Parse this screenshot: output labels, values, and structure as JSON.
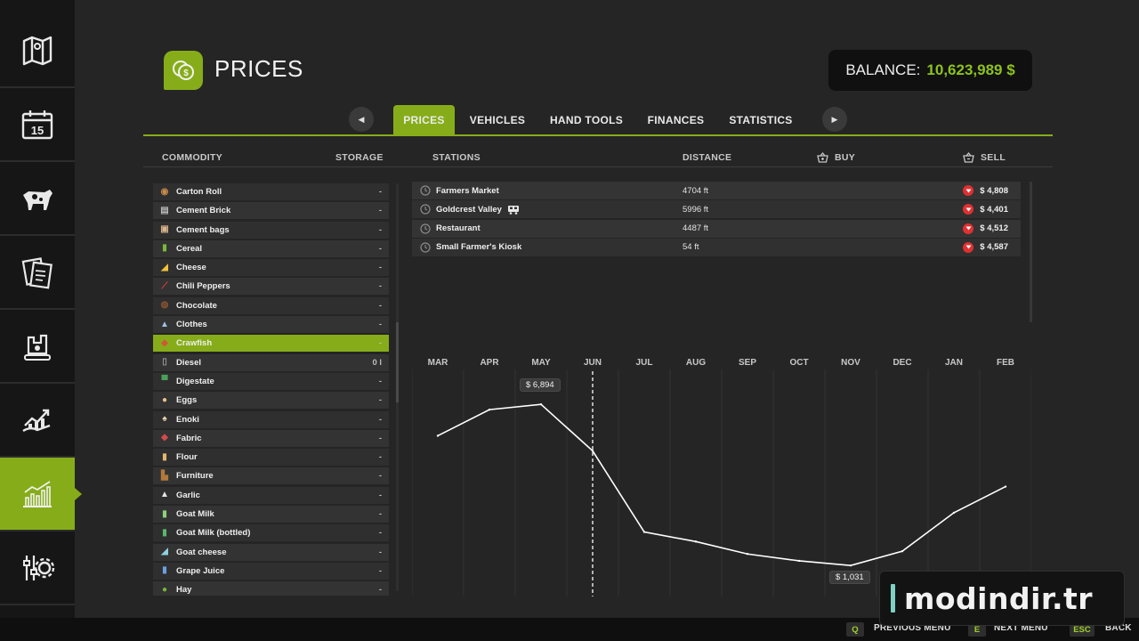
{
  "sidebar": {
    "items": [
      {
        "name": "map",
        "active": false
      },
      {
        "name": "calendar",
        "active": false,
        "badge": "15"
      },
      {
        "name": "animals",
        "active": false
      },
      {
        "name": "contracts",
        "active": false
      },
      {
        "name": "production",
        "active": false
      },
      {
        "name": "finances",
        "active": false
      },
      {
        "name": "prices",
        "active": true
      },
      {
        "name": "settings",
        "active": false
      }
    ]
  },
  "header": {
    "title": "PRICES",
    "balance_label": "BALANCE:",
    "balance_value": "10,623,989 $"
  },
  "tabs": [
    {
      "label": "PRICES",
      "active": true
    },
    {
      "label": "VEHICLES",
      "active": false
    },
    {
      "label": "HAND TOOLS",
      "active": false
    },
    {
      "label": "FINANCES",
      "active": false
    },
    {
      "label": "STATISTICS",
      "active": false
    }
  ],
  "columns": {
    "commodity": "COMMODITY",
    "storage": "STORAGE",
    "stations": "STATIONS",
    "distance": "DISTANCE",
    "buy": "BUY",
    "sell": "SELL"
  },
  "commodities": [
    {
      "name": "Carton Roll",
      "storage": "-",
      "icon": "carton-roll-icon",
      "glyph": "◉",
      "color": "#c98a4a"
    },
    {
      "name": "Cement Brick",
      "storage": "-",
      "icon": "cement-brick-icon",
      "glyph": "▤",
      "color": "#b8b8b8"
    },
    {
      "name": "Cement bags",
      "storage": "-",
      "icon": "cement-bags-icon",
      "glyph": "▣",
      "color": "#d8b48a"
    },
    {
      "name": "Cereal",
      "storage": "-",
      "icon": "cereal-icon",
      "glyph": "▮",
      "color": "#79b83a"
    },
    {
      "name": "Cheese",
      "storage": "-",
      "icon": "cheese-icon",
      "glyph": "◢",
      "color": "#f0c23a"
    },
    {
      "name": "Chili Peppers",
      "storage": "-",
      "icon": "chili-peppers-icon",
      "glyph": "⟋",
      "color": "#e04030"
    },
    {
      "name": "Chocolate",
      "storage": "-",
      "icon": "chocolate-icon",
      "glyph": "◍",
      "color": "#8a5530"
    },
    {
      "name": "Clothes",
      "storage": "-",
      "icon": "clothes-icon",
      "glyph": "▲",
      "color": "#9cc0e0"
    },
    {
      "name": "Crawfish",
      "storage": "-",
      "icon": "crawfish-icon",
      "glyph": "◆",
      "color": "#d0583a",
      "active": true
    },
    {
      "name": "Diesel",
      "storage": "0 l",
      "icon": "diesel-icon",
      "glyph": "▯",
      "color": "#9a9a9a"
    },
    {
      "name": "Digestate",
      "storage": "-",
      "icon": "digestate-icon",
      "glyph": "▀",
      "color": "#4aa05a"
    },
    {
      "name": "Eggs",
      "storage": "-",
      "icon": "eggs-icon",
      "glyph": "●",
      "color": "#e8c28a"
    },
    {
      "name": "Enoki",
      "storage": "-",
      "icon": "enoki-icon",
      "glyph": "♠",
      "color": "#e8d8b0"
    },
    {
      "name": "Fabric",
      "storage": "-",
      "icon": "fabric-icon",
      "glyph": "◆",
      "color": "#d24a4a"
    },
    {
      "name": "Flour",
      "storage": "-",
      "icon": "flour-icon",
      "glyph": "▮",
      "color": "#e0b870"
    },
    {
      "name": "Furniture",
      "storage": "-",
      "icon": "furniture-icon",
      "glyph": "▙",
      "color": "#b07a3a"
    },
    {
      "name": "Garlic",
      "storage": "-",
      "icon": "garlic-icon",
      "glyph": "▲",
      "color": "#e6e6e6"
    },
    {
      "name": "Goat Milk",
      "storage": "-",
      "icon": "goat-milk-icon",
      "glyph": "▮",
      "color": "#8fd07a"
    },
    {
      "name": "Goat Milk (bottled)",
      "storage": "-",
      "icon": "goat-milk-bottled-icon",
      "glyph": "▮",
      "color": "#5ab86a"
    },
    {
      "name": "Goat cheese",
      "storage": "-",
      "icon": "goat-cheese-icon",
      "glyph": "◢",
      "color": "#8fd0e0"
    },
    {
      "name": "Grape Juice",
      "storage": "-",
      "icon": "grape-juice-icon",
      "glyph": "▮",
      "color": "#6aa0e0"
    },
    {
      "name": "Hay",
      "storage": "-",
      "icon": "hay-icon",
      "glyph": "●",
      "color": "#79b83a"
    }
  ],
  "stations": [
    {
      "name": "Farmers Market",
      "distance": "4704 ft",
      "sell": "$ 4,808",
      "train": false
    },
    {
      "name": "Goldcrest Valley",
      "distance": "5996 ft",
      "sell": "$ 4,401",
      "train": true
    },
    {
      "name": "Restaurant",
      "distance": "4487 ft",
      "sell": "$ 4,512",
      "train": false
    },
    {
      "name": "Small Farmer's Kiosk",
      "distance": "54 ft",
      "sell": "$ 4,587",
      "train": false
    }
  ],
  "chart_data": {
    "type": "line",
    "categories": [
      "MAR",
      "APR",
      "MAY",
      "JUN",
      "JUL",
      "AUG",
      "SEP",
      "OCT",
      "NOV",
      "DEC",
      "JAN",
      "FEB"
    ],
    "values": [
      5750,
      6700,
      6894,
      5200,
      2250,
      1900,
      1450,
      1200,
      1031,
      1550,
      2950,
      3900
    ],
    "current_month": "JUN",
    "max_label": "$ 6,894",
    "min_label": "$ 1,031",
    "ylim": [
      0,
      8000
    ],
    "grid": true,
    "line_color": "#ffffff"
  },
  "footer": {
    "prev_key": "Q",
    "prev_label": "PREVIOUS MENU",
    "next_key": "E",
    "next_label": "NEXT MENU",
    "back_key": "ESC",
    "back_label": "BACK"
  },
  "watermark": "modindir.tr"
}
